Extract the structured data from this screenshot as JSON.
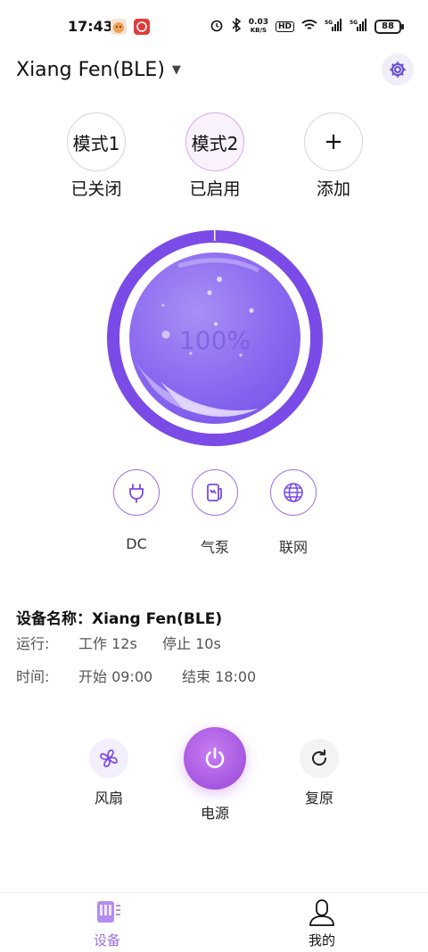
{
  "status_bar": {
    "time": "17:43",
    "net_speed_value": "0.03",
    "net_speed_unit": "KB/S",
    "hd_badge": "HD",
    "battery": "88"
  },
  "header": {
    "device_name": "Xiang Fen(BLE)"
  },
  "modes": [
    {
      "label": "模式1",
      "status": "已关闭",
      "active": false
    },
    {
      "label": "模式2",
      "status": "已启用",
      "active": true
    },
    {
      "label": "+",
      "status": "添加",
      "active": false
    }
  ],
  "gauge": {
    "level_text": "100%",
    "level_fraction": 1.0,
    "ring_color": "#7a4be6",
    "fill_color": "#8f6cf0"
  },
  "features": [
    {
      "label": "DC",
      "icon": "plug-icon"
    },
    {
      "label": "气泵",
      "icon": "air-pump-icon"
    },
    {
      "label": "联网",
      "icon": "globe-icon"
    }
  ],
  "info": {
    "name_label": "设备名称：",
    "name_value": "Xiang Fen(BLE)",
    "run_label": "运行:",
    "work": "工作 12s",
    "stop": "停止 10s",
    "time_label": "时间:",
    "start": "开始 09:00",
    "end": "结束 18:00"
  },
  "controls": {
    "fan_label": "风扇",
    "power_label": "电源",
    "reset_label": "复原"
  },
  "bottom_nav": {
    "device_tab": "设备",
    "mine_tab": "我的",
    "active_color": "#9b6fe0"
  }
}
